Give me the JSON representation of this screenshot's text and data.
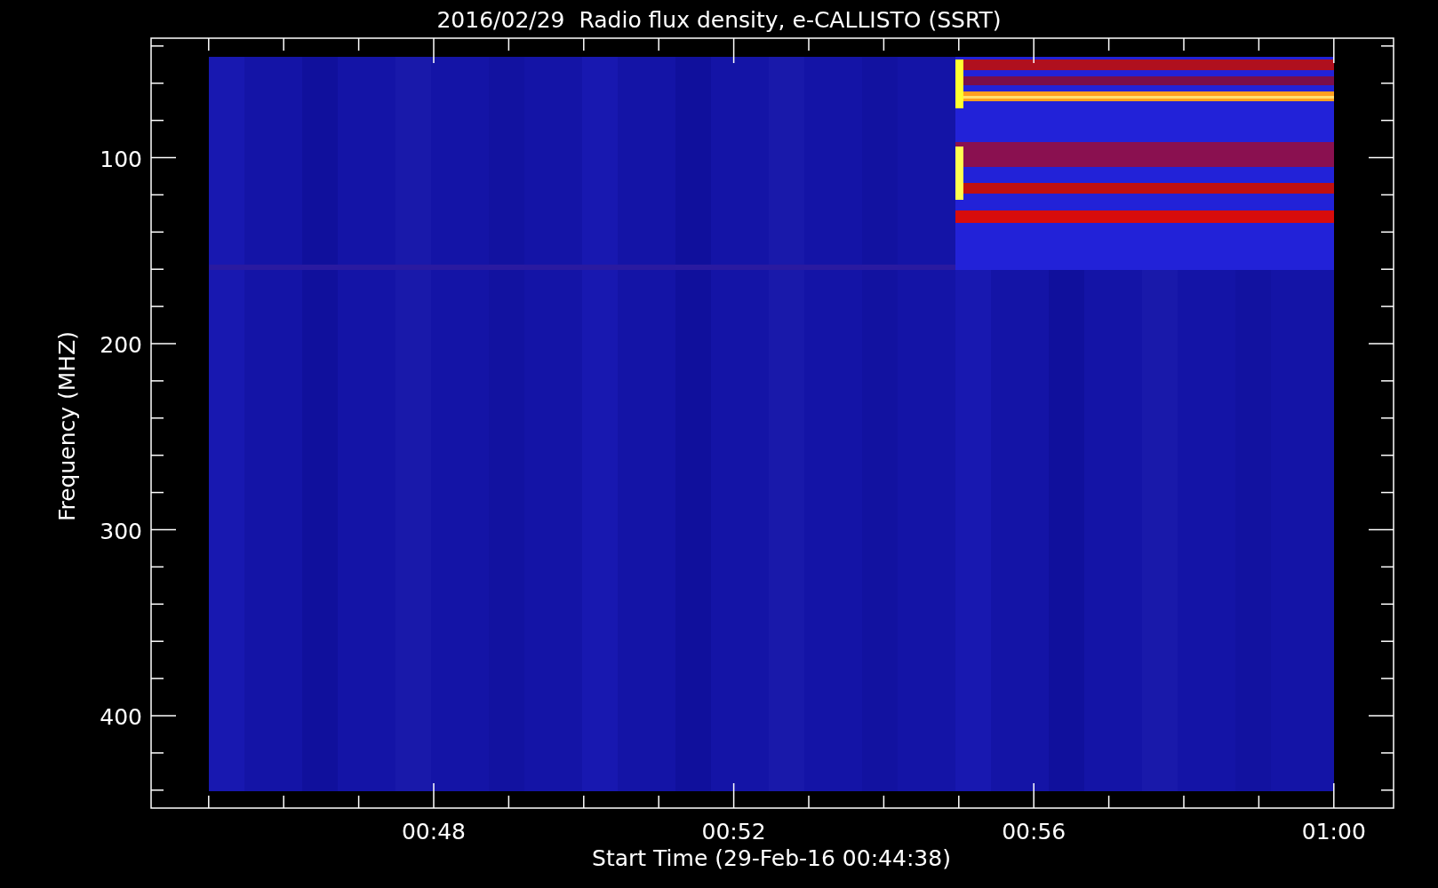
{
  "title": "2016/02/29  Radio flux density, e-CALLISTO (SSRT)",
  "plot": {
    "ylabel": "Frequency (MHZ)",
    "xlabel": "Start Time (29-Feb-16 00:44:38)",
    "yticks": [
      "100",
      "200",
      "300",
      "400"
    ],
    "xticks": [
      "00:48",
      "00:52",
      "00:56",
      "01:00"
    ]
  }
}
